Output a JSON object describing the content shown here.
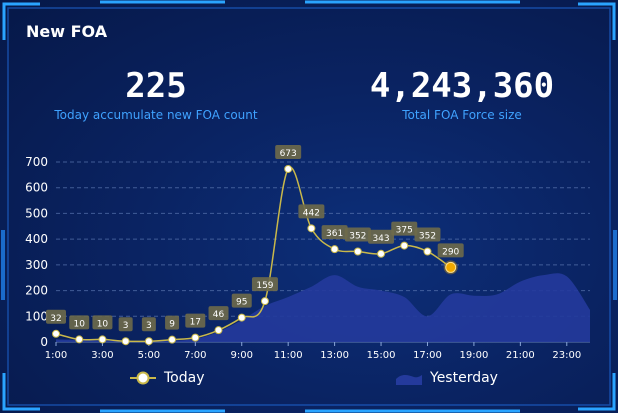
{
  "panel": {
    "title": "New FOA"
  },
  "stats": [
    {
      "value": "225",
      "label": "Today accumulate new FOA count"
    },
    {
      "value": "4,243,360",
      "label": "Total FOA Force size"
    }
  ],
  "legend": {
    "today": "Today",
    "yesterday": "Yesterday"
  },
  "colors": {
    "today_line": "#c9b84a",
    "today_point": "#ffffff",
    "yesterday_area": "#243a9c",
    "accent": "#3fa2ff",
    "current_point": "#f0a800"
  },
  "chart_data": {
    "type": "line",
    "x_ticks": [
      "1:00",
      "3:00",
      "5:00",
      "7:00",
      "9:00",
      "11:00",
      "13:00",
      "15:00",
      "17:00",
      "19:00",
      "21:00",
      "23:00"
    ],
    "y_ticks": [
      0,
      100,
      200,
      300,
      400,
      500,
      600,
      700
    ],
    "ylim": [
      0,
      700
    ],
    "xlim": [
      1,
      24
    ],
    "grid": true,
    "legend_position": "bottom",
    "series": [
      {
        "name": "Today",
        "x": [
          1,
          2,
          3,
          4,
          5,
          6,
          7,
          8,
          9,
          10,
          11,
          12,
          13,
          14,
          15,
          16,
          17,
          18
        ],
        "values": [
          32,
          10,
          10,
          3,
          3,
          9,
          17,
          46,
          95,
          159,
          673,
          442,
          361,
          352,
          343,
          375,
          352,
          290
        ]
      },
      {
        "name": "Yesterday",
        "x": [
          1,
          2,
          3,
          4,
          5,
          6,
          7,
          8,
          9,
          10,
          11,
          12,
          13,
          14,
          15,
          16,
          17,
          18,
          19,
          20,
          21,
          22,
          23,
          24
        ],
        "values": [
          10,
          8,
          6,
          4,
          3,
          5,
          12,
          40,
          85,
          140,
          175,
          215,
          260,
          215,
          200,
          175,
          100,
          185,
          180,
          185,
          235,
          260,
          255,
          125
        ]
      }
    ]
  }
}
